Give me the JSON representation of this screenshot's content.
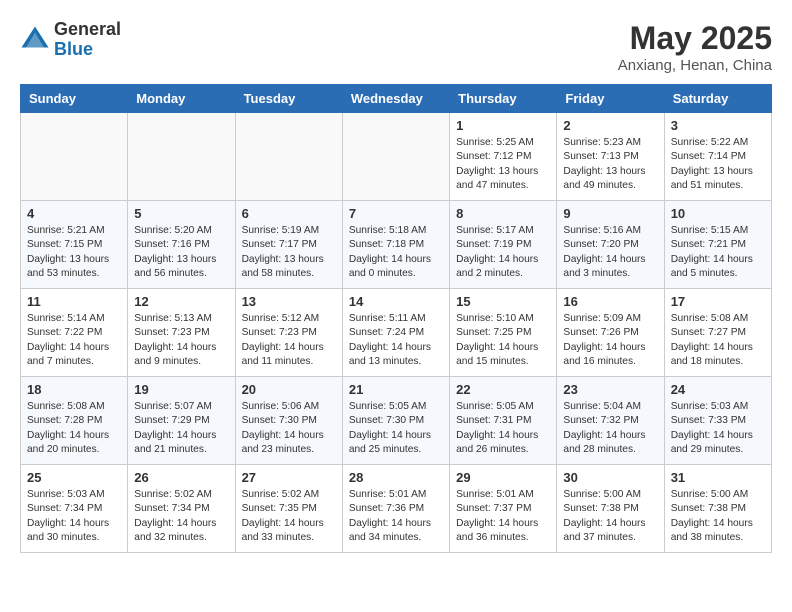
{
  "header": {
    "logo_general": "General",
    "logo_blue": "Blue",
    "month_title": "May 2025",
    "location": "Anxiang, Henan, China"
  },
  "weekdays": [
    "Sunday",
    "Monday",
    "Tuesday",
    "Wednesday",
    "Thursday",
    "Friday",
    "Saturday"
  ],
  "weeks": [
    [
      {
        "day": "",
        "sunrise": "",
        "sunset": "",
        "daylight": ""
      },
      {
        "day": "",
        "sunrise": "",
        "sunset": "",
        "daylight": ""
      },
      {
        "day": "",
        "sunrise": "",
        "sunset": "",
        "daylight": ""
      },
      {
        "day": "",
        "sunrise": "",
        "sunset": "",
        "daylight": ""
      },
      {
        "day": "1",
        "sunrise": "Sunrise: 5:25 AM",
        "sunset": "Sunset: 7:12 PM",
        "daylight": "Daylight: 13 hours and 47 minutes."
      },
      {
        "day": "2",
        "sunrise": "Sunrise: 5:23 AM",
        "sunset": "Sunset: 7:13 PM",
        "daylight": "Daylight: 13 hours and 49 minutes."
      },
      {
        "day": "3",
        "sunrise": "Sunrise: 5:22 AM",
        "sunset": "Sunset: 7:14 PM",
        "daylight": "Daylight: 13 hours and 51 minutes."
      }
    ],
    [
      {
        "day": "4",
        "sunrise": "Sunrise: 5:21 AM",
        "sunset": "Sunset: 7:15 PM",
        "daylight": "Daylight: 13 hours and 53 minutes."
      },
      {
        "day": "5",
        "sunrise": "Sunrise: 5:20 AM",
        "sunset": "Sunset: 7:16 PM",
        "daylight": "Daylight: 13 hours and 56 minutes."
      },
      {
        "day": "6",
        "sunrise": "Sunrise: 5:19 AM",
        "sunset": "Sunset: 7:17 PM",
        "daylight": "Daylight: 13 hours and 58 minutes."
      },
      {
        "day": "7",
        "sunrise": "Sunrise: 5:18 AM",
        "sunset": "Sunset: 7:18 PM",
        "daylight": "Daylight: 14 hours and 0 minutes."
      },
      {
        "day": "8",
        "sunrise": "Sunrise: 5:17 AM",
        "sunset": "Sunset: 7:19 PM",
        "daylight": "Daylight: 14 hours and 2 minutes."
      },
      {
        "day": "9",
        "sunrise": "Sunrise: 5:16 AM",
        "sunset": "Sunset: 7:20 PM",
        "daylight": "Daylight: 14 hours and 3 minutes."
      },
      {
        "day": "10",
        "sunrise": "Sunrise: 5:15 AM",
        "sunset": "Sunset: 7:21 PM",
        "daylight": "Daylight: 14 hours and 5 minutes."
      }
    ],
    [
      {
        "day": "11",
        "sunrise": "Sunrise: 5:14 AM",
        "sunset": "Sunset: 7:22 PM",
        "daylight": "Daylight: 14 hours and 7 minutes."
      },
      {
        "day": "12",
        "sunrise": "Sunrise: 5:13 AM",
        "sunset": "Sunset: 7:23 PM",
        "daylight": "Daylight: 14 hours and 9 minutes."
      },
      {
        "day": "13",
        "sunrise": "Sunrise: 5:12 AM",
        "sunset": "Sunset: 7:23 PM",
        "daylight": "Daylight: 14 hours and 11 minutes."
      },
      {
        "day": "14",
        "sunrise": "Sunrise: 5:11 AM",
        "sunset": "Sunset: 7:24 PM",
        "daylight": "Daylight: 14 hours and 13 minutes."
      },
      {
        "day": "15",
        "sunrise": "Sunrise: 5:10 AM",
        "sunset": "Sunset: 7:25 PM",
        "daylight": "Daylight: 14 hours and 15 minutes."
      },
      {
        "day": "16",
        "sunrise": "Sunrise: 5:09 AM",
        "sunset": "Sunset: 7:26 PM",
        "daylight": "Daylight: 14 hours and 16 minutes."
      },
      {
        "day": "17",
        "sunrise": "Sunrise: 5:08 AM",
        "sunset": "Sunset: 7:27 PM",
        "daylight": "Daylight: 14 hours and 18 minutes."
      }
    ],
    [
      {
        "day": "18",
        "sunrise": "Sunrise: 5:08 AM",
        "sunset": "Sunset: 7:28 PM",
        "daylight": "Daylight: 14 hours and 20 minutes."
      },
      {
        "day": "19",
        "sunrise": "Sunrise: 5:07 AM",
        "sunset": "Sunset: 7:29 PM",
        "daylight": "Daylight: 14 hours and 21 minutes."
      },
      {
        "day": "20",
        "sunrise": "Sunrise: 5:06 AM",
        "sunset": "Sunset: 7:30 PM",
        "daylight": "Daylight: 14 hours and 23 minutes."
      },
      {
        "day": "21",
        "sunrise": "Sunrise: 5:05 AM",
        "sunset": "Sunset: 7:30 PM",
        "daylight": "Daylight: 14 hours and 25 minutes."
      },
      {
        "day": "22",
        "sunrise": "Sunrise: 5:05 AM",
        "sunset": "Sunset: 7:31 PM",
        "daylight": "Daylight: 14 hours and 26 minutes."
      },
      {
        "day": "23",
        "sunrise": "Sunrise: 5:04 AM",
        "sunset": "Sunset: 7:32 PM",
        "daylight": "Daylight: 14 hours and 28 minutes."
      },
      {
        "day": "24",
        "sunrise": "Sunrise: 5:03 AM",
        "sunset": "Sunset: 7:33 PM",
        "daylight": "Daylight: 14 hours and 29 minutes."
      }
    ],
    [
      {
        "day": "25",
        "sunrise": "Sunrise: 5:03 AM",
        "sunset": "Sunset: 7:34 PM",
        "daylight": "Daylight: 14 hours and 30 minutes."
      },
      {
        "day": "26",
        "sunrise": "Sunrise: 5:02 AM",
        "sunset": "Sunset: 7:34 PM",
        "daylight": "Daylight: 14 hours and 32 minutes."
      },
      {
        "day": "27",
        "sunrise": "Sunrise: 5:02 AM",
        "sunset": "Sunset: 7:35 PM",
        "daylight": "Daylight: 14 hours and 33 minutes."
      },
      {
        "day": "28",
        "sunrise": "Sunrise: 5:01 AM",
        "sunset": "Sunset: 7:36 PM",
        "daylight": "Daylight: 14 hours and 34 minutes."
      },
      {
        "day": "29",
        "sunrise": "Sunrise: 5:01 AM",
        "sunset": "Sunset: 7:37 PM",
        "daylight": "Daylight: 14 hours and 36 minutes."
      },
      {
        "day": "30",
        "sunrise": "Sunrise: 5:00 AM",
        "sunset": "Sunset: 7:38 PM",
        "daylight": "Daylight: 14 hours and 37 minutes."
      },
      {
        "day": "31",
        "sunrise": "Sunrise: 5:00 AM",
        "sunset": "Sunset: 7:38 PM",
        "daylight": "Daylight: 14 hours and 38 minutes."
      }
    ]
  ]
}
